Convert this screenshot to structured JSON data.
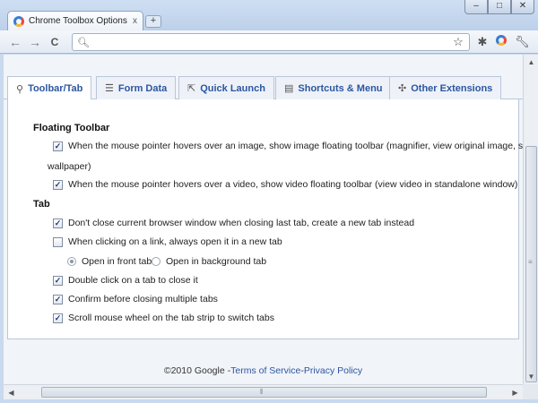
{
  "browser": {
    "tab_title": "Chrome Toolbox Options",
    "tab_close": "x",
    "new_tab": "+",
    "window_buttons": [
      "–",
      "□",
      "✕"
    ],
    "back": "←",
    "forward": "→",
    "reload": "C",
    "omnibox_icon": "search-icon",
    "toolbar_icons": [
      "star-icon",
      "extension-icon",
      "toolbox-icon",
      "wrench-icon"
    ]
  },
  "options_tabs": [
    {
      "label": "Toolbar/Tab",
      "icon": "pin-icon",
      "active": true
    },
    {
      "label": "Form Data",
      "icon": "list-icon",
      "active": false
    },
    {
      "label": "Quick Launch",
      "icon": "launch-icon",
      "active": false
    },
    {
      "label": "Shortcuts & Menu",
      "icon": "menu-icon",
      "active": false
    },
    {
      "label": "Other Extensions",
      "icon": "puzzle-icon",
      "active": false
    }
  ],
  "floating_toolbar": {
    "title": "Floating Toolbar",
    "image_option_line1": "When the mouse pointer hovers over an image, show image floating toolbar (magnifier, view original image, set",
    "image_option_line2": "wallpaper)",
    "image_checked": true,
    "video_option": "When the mouse pointer hovers over a video, show video floating toolbar (view video in standalone window)",
    "video_checked": true
  },
  "tab_section": {
    "title": "Tab",
    "dont_close": {
      "label": "Don't close current browser window when closing last tab, create a new tab instead",
      "checked": true
    },
    "open_new_tab": {
      "label": "When clicking on a link, always open it in a new tab",
      "checked": false
    },
    "radio_front": {
      "label": "Open in front tab",
      "selected": true
    },
    "radio_background": {
      "label": "Open in background tab",
      "selected": false
    },
    "double_click": {
      "label": "Double click on a tab to close it",
      "checked": true
    },
    "confirm_close": {
      "label": "Confirm before closing multiple tabs",
      "checked": true
    },
    "scroll_switch": {
      "label": "Scroll mouse wheel on the tab strip to switch tabs",
      "checked": true
    }
  },
  "footer": {
    "copyright": "©2010 Google - ",
    "terms": "Terms of Service",
    "separator": " - ",
    "privacy": "Privacy Policy"
  }
}
